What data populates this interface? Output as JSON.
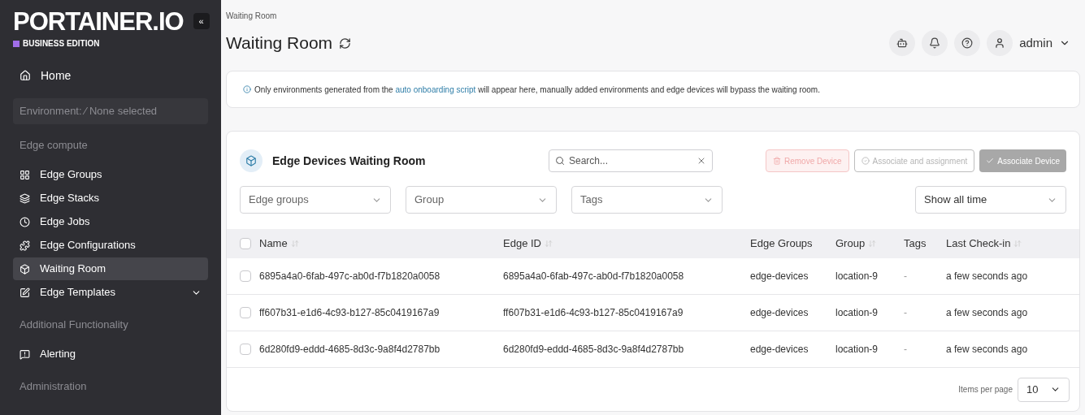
{
  "sidebar": {
    "logo": "PORTAINER.IO",
    "edition": "BUSINESS EDITION",
    "collapse": "«",
    "home": "Home",
    "environment": "Environment: ⁄ None selected",
    "sections": [
      {
        "title": "Edge compute",
        "items": [
          {
            "label": "Edge Groups",
            "selected": false,
            "expandable": false
          },
          {
            "label": "Edge Stacks",
            "selected": false,
            "expandable": false
          },
          {
            "label": "Edge Jobs",
            "selected": false,
            "expandable": false
          },
          {
            "label": "Edge Configurations",
            "selected": false,
            "expandable": false
          },
          {
            "label": "Waiting Room",
            "selected": true,
            "expandable": false
          },
          {
            "label": "Edge Templates",
            "selected": false,
            "expandable": true
          }
        ]
      },
      {
        "title": "Additional Functionality",
        "items": [
          {
            "label": "Alerting",
            "selected": false,
            "expandable": false
          }
        ]
      },
      {
        "title": "Administration"
      }
    ]
  },
  "header": {
    "breadcrumb": "Waiting Room",
    "title": "Waiting Room",
    "user": "admin"
  },
  "notice": {
    "before": "Only environments generated from the ",
    "link": "auto onboarding script",
    "after": " will appear here, manually added environments and edge devices will bypass the waiting room."
  },
  "panel": {
    "title": "Edge Devices Waiting Room",
    "search": {
      "placeholder": "Search..."
    },
    "buttons": [
      {
        "label": "Remove Device",
        "kind": "danger",
        "disabled": true
      },
      {
        "label": "Associate and assignment",
        "kind": "outline",
        "disabled": true
      },
      {
        "label": "Associate Device",
        "kind": "primary",
        "disabled": true
      }
    ],
    "filters": [
      {
        "placeholder": "Edge groups"
      },
      {
        "placeholder": "Group"
      },
      {
        "placeholder": "Tags"
      }
    ],
    "time_filter": "Show all time",
    "select_all": {
      "checked": false
    },
    "columns": [
      {
        "label": "Name",
        "sortable": true
      },
      {
        "label": "Edge ID",
        "sortable": true
      },
      {
        "label": "Edge Groups",
        "sortable": false
      },
      {
        "label": "Group",
        "sortable": true
      },
      {
        "label": "Tags",
        "sortable": false
      },
      {
        "label": "Last Check-in",
        "sortable": true
      }
    ],
    "rows": [
      {
        "selected": false,
        "cells": [
          "6895a4a0-6fab-497c-ab0d-f7b1820a0058",
          "6895a4a0-6fab-497c-ab0d-f7b1820a0058",
          "edge-devices",
          "location-9",
          "-",
          "a few seconds ago"
        ]
      },
      {
        "selected": false,
        "cells": [
          "ff607b31-e1d6-4c93-b127-85c0419167a9",
          "ff607b31-e1d6-4c93-b127-85c0419167a9",
          "edge-devices",
          "location-9",
          "-",
          "a few seconds ago"
        ]
      },
      {
        "selected": false,
        "cells": [
          "6d280fd9-eddd-4685-8d3c-9a8f4d2787bb",
          "6d280fd9-eddd-4685-8d3c-9a8f4d2787bb",
          "edge-devices",
          "location-9",
          "-",
          "a few seconds ago"
        ]
      }
    ],
    "pagination": {
      "label": "Items per page",
      "value": "10"
    }
  }
}
